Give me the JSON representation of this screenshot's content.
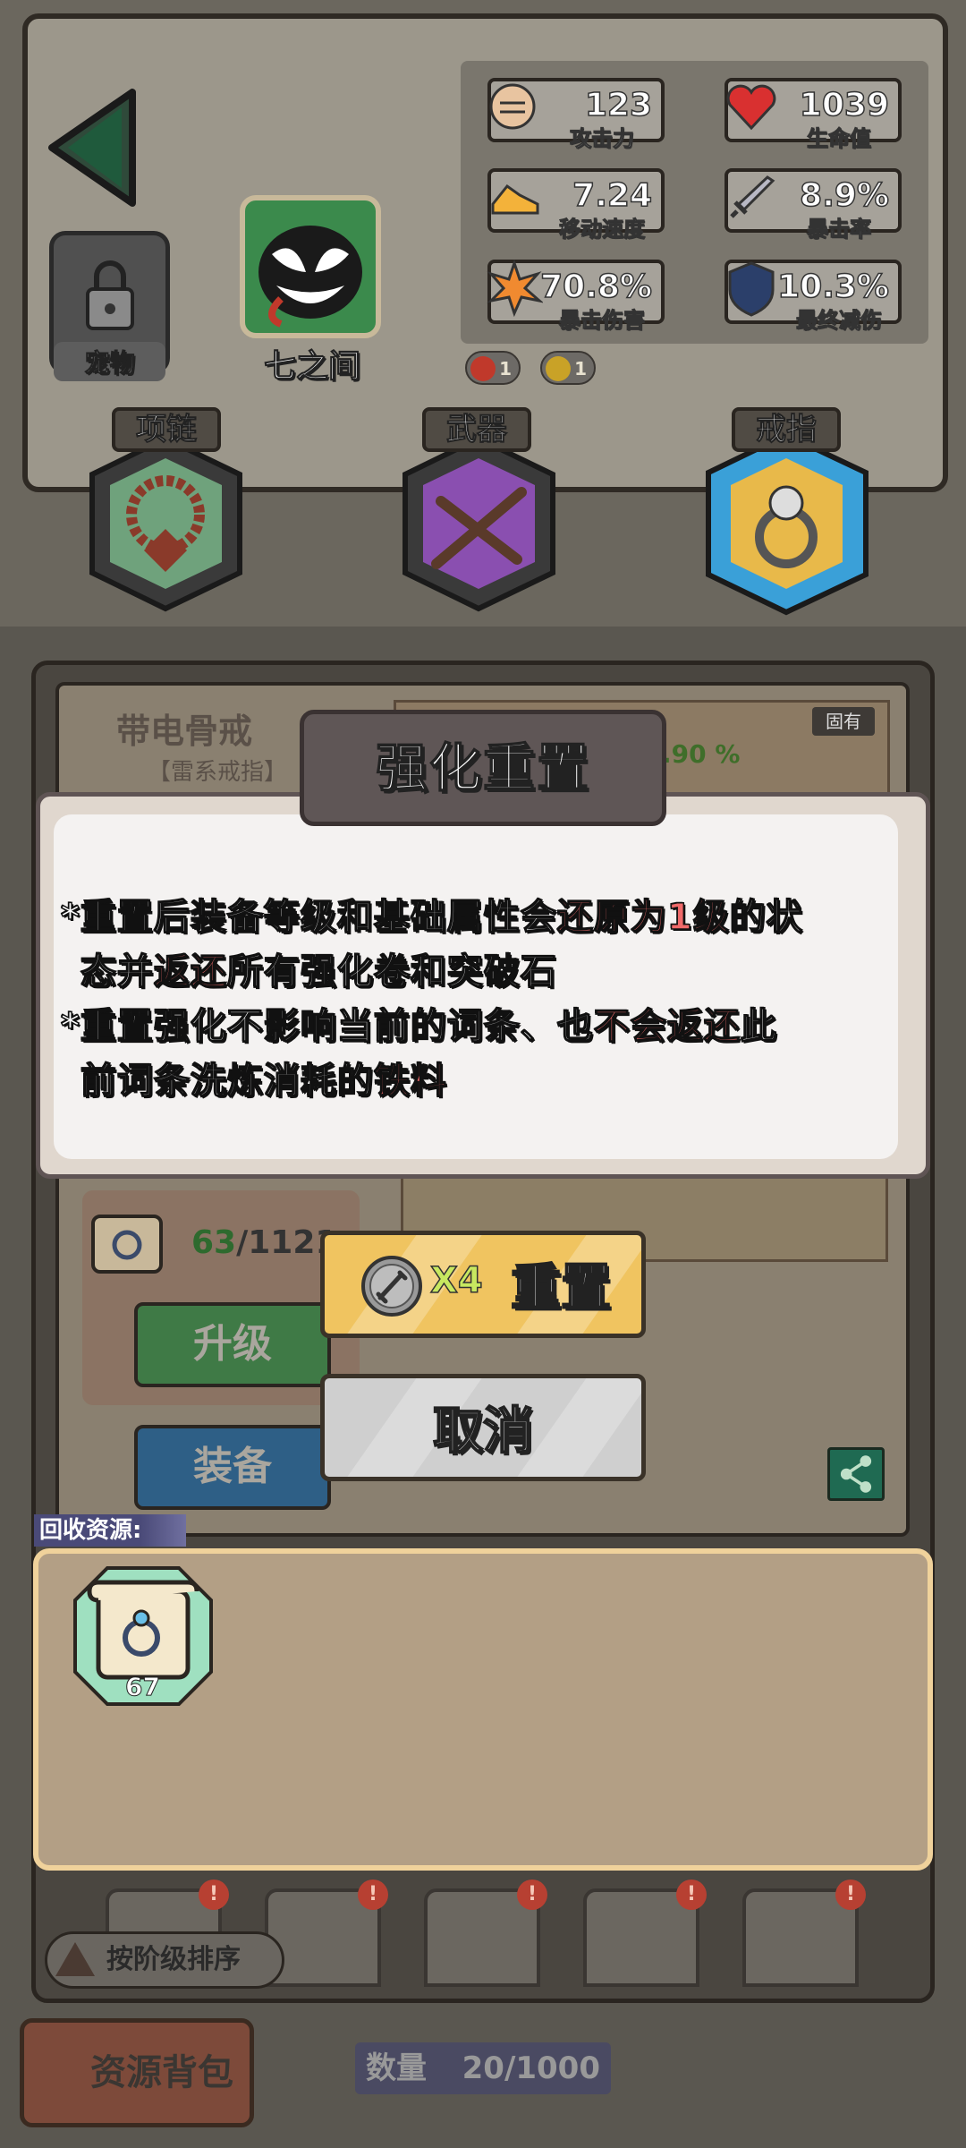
{
  "character": {
    "name": "七之间",
    "pet_label": "宠物"
  },
  "stats": [
    {
      "icon": "fist-icon",
      "value": "123",
      "label": "攻击力"
    },
    {
      "icon": "heart-icon",
      "value": "1039",
      "label": "生命值"
    },
    {
      "icon": "shoe-icon",
      "value": "7.24",
      "label": "移动速度"
    },
    {
      "icon": "sword-icon",
      "value": "8.9%",
      "label": "暴击率"
    },
    {
      "icon": "explosion-icon",
      "value": "70.8%",
      "label": "暴击伤害"
    },
    {
      "icon": "shield-icon",
      "value": "10.3%",
      "label": "最终减伤"
    }
  ],
  "buffs": [
    {
      "icon": "fire-buff-icon",
      "count": "1",
      "color": "#c0392b"
    },
    {
      "icon": "lightning-buff-icon",
      "count": "1",
      "color": "#c9a227"
    }
  ],
  "equipment_slots": [
    {
      "title": "项链",
      "icon": "necklace-icon",
      "color": "#6fa27c"
    },
    {
      "title": "武器",
      "icon": "crossbow-icon",
      "color": "#8a4fb0"
    },
    {
      "title": "戒指",
      "icon": "ring-icon",
      "color": "#e8b94a"
    }
  ],
  "item": {
    "name": "带电骨戒",
    "type": "【雷系戒指】",
    "badge": "固有",
    "attr_percent": ".90 %",
    "progress_current": "63",
    "progress_rest": "/1121",
    "upgrade_label": "升级",
    "equip_label": "装备"
  },
  "modal": {
    "title": "强化重置",
    "line1": {
      "a": "*重置后装备等级和基础属性会",
      "hl": "还原为1级",
      "b": "的状"
    },
    "line2": {
      "a": "态并",
      "hl": "返还",
      "b": "所有强化卷和突破石"
    },
    "line3": {
      "a": "*重置强化不影响当前的词条、也",
      "hl": "不会返还",
      "b": "此"
    },
    "line4": {
      "a": "前词条洗炼消耗的",
      "hl": "铁料",
      "b": ""
    },
    "reset_cost": "X4",
    "reset_label": "重置",
    "cancel_label": "取消"
  },
  "recycle": {
    "label": "回收资源:",
    "items": [
      {
        "icon": "ring-scroll-icon",
        "count": "67"
      }
    ]
  },
  "filters": [
    "fire-ring-icon",
    "diamond-ring-icon",
    "swirl-ring-icon",
    "spiked-ring-icon",
    "spiked-ring-icon"
  ],
  "sort_label": "按阶级排序",
  "bag_label": "资源背包",
  "count": {
    "label": "数量",
    "value": "20/1000"
  }
}
